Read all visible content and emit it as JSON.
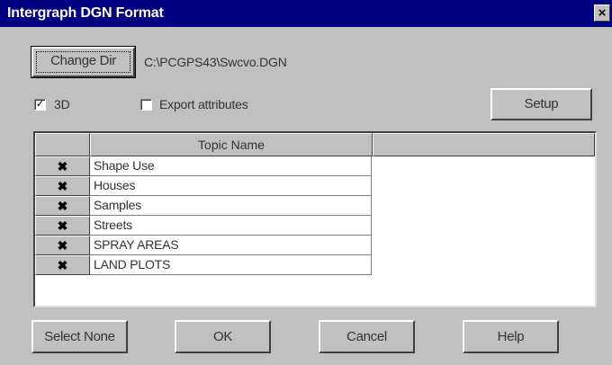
{
  "window": {
    "title": "Intergraph DGN Format",
    "close_glyph": "×"
  },
  "toolbar": {
    "change_dir_label": "Change Dir",
    "path": "C:\\PCGPS43\\Swcvo.DGN"
  },
  "options": {
    "three_d": {
      "label": "3D",
      "checked": true
    },
    "export_attributes": {
      "label": "Export attributes",
      "checked": false
    },
    "setup_label": "Setup"
  },
  "grid": {
    "column_header": "Topic Name",
    "rows": [
      {
        "checked": true,
        "name": "Shape Use"
      },
      {
        "checked": true,
        "name": "Houses"
      },
      {
        "checked": true,
        "name": "Samples"
      },
      {
        "checked": true,
        "name": "Streets"
      },
      {
        "checked": true,
        "name": "SPRAY AREAS"
      },
      {
        "checked": true,
        "name": "LAND PLOTS"
      }
    ]
  },
  "buttons": {
    "select_none": "Select None",
    "ok": "OK",
    "cancel": "Cancel",
    "help": "Help"
  },
  "glyphs": {
    "check": "✓",
    "row_check": "✖"
  }
}
